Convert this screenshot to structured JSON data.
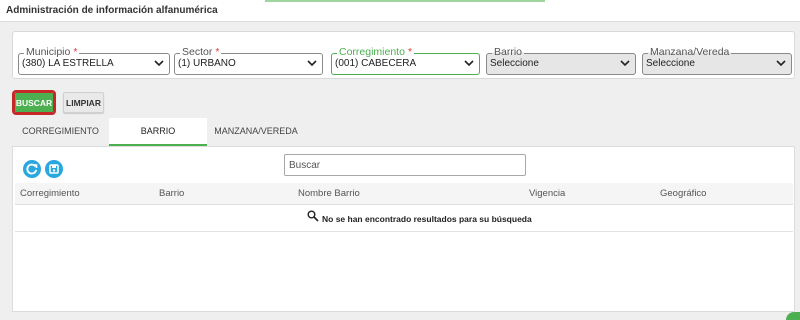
{
  "header": {
    "title": "Administración de información alfanumérica"
  },
  "filters": {
    "municipio": {
      "label": "Municipio",
      "required": "*",
      "value": "(380) LA ESTRELLA"
    },
    "sector": {
      "label": "Sector",
      "required": "*",
      "value": "(1) URBANO"
    },
    "corregimiento": {
      "label": "Corregimiento",
      "required": "*",
      "value": "(001) CABECERA"
    },
    "barrio": {
      "label": "Barrio",
      "value": "Seleccione"
    },
    "manzana": {
      "label": "Manzana/Vereda",
      "value": "Seleccione"
    }
  },
  "actions": {
    "buscar": "BUSCAR",
    "limpiar": "LIMPIAR"
  },
  "tabs": [
    {
      "label": "CORREGIMIENTO"
    },
    {
      "label": "BARRIO"
    },
    {
      "label": "MANZANA/VEREDA"
    }
  ],
  "table": {
    "search_placeholder": "Buscar",
    "columns": [
      "Corregimiento",
      "Barrio",
      "Nombre Barrio",
      "Vigencia",
      "Geográfico"
    ],
    "empty_message": "No se han encontrado resultados para su búsqueda"
  },
  "colors": {
    "accent": "#4caf50",
    "icon_blue": "#29a8e0",
    "highlight_border": "#c62828",
    "required": "#e53935"
  },
  "icons": [
    "chevron-down-icon",
    "refresh-icon",
    "save-icon",
    "search-icon"
  ]
}
